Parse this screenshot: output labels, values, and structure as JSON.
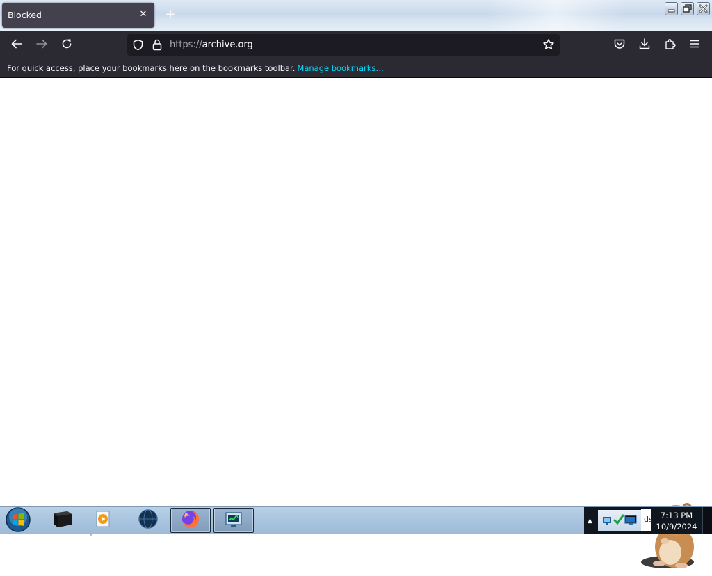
{
  "tab": {
    "title": "Blocked",
    "close_glyph": "✕",
    "new_tab_glyph": "+"
  },
  "window_controls": [
    "minimize",
    "restore",
    "close"
  ],
  "navbar": {
    "url_scheme": "https://",
    "url_host": "archive.org",
    "icons": [
      "back-arrow-icon",
      "forward-arrow-icon",
      "reload-icon",
      "shield-icon",
      "lock-icon",
      "star-icon",
      "pocket-icon",
      "download-icon",
      "extensions-icon",
      "menu-icon"
    ]
  },
  "bookmarks_bar": {
    "message": "For quick access, place your bookmarks here on the bookmarks toolbar.",
    "link": "Manage bookmarks…"
  },
  "taskbar": {
    "apps": [
      "start-orb",
      "terminal",
      "media-player",
      "globe",
      "firefox",
      "task-manager"
    ],
    "tray_partial_text": "ds",
    "clock": {
      "time": "7:13 PM",
      "date": "10/9/2024"
    }
  },
  "colors": {
    "toolbar": "#2b2a33",
    "urlbar": "#1c1b22",
    "tab": "#42414d",
    "link": "#00ddff",
    "taskbar": "#a9c4df"
  }
}
